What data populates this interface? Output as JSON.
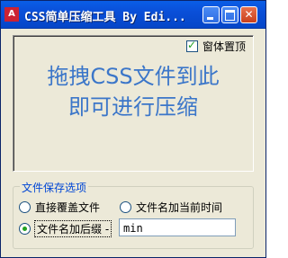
{
  "window": {
    "title": "CSS简单压缩工具 By Edi...",
    "app_icon": "A",
    "minimize_icon": "minimize-icon",
    "maximize_icon": "maximize-icon",
    "close_glyph": "✕"
  },
  "drop_area": {
    "always_on_top_label": "窗体置顶",
    "always_on_top_checked": true,
    "hint_line1": "拖拽CSS文件到此",
    "hint_line2": "即可进行压缩"
  },
  "save_options": {
    "legend": "文件保存选项",
    "options": [
      {
        "label": "直接覆盖文件",
        "selected": false
      },
      {
        "label": "文件名加当前时间",
        "selected": false
      },
      {
        "label": "文件名加后缀 -",
        "selected": true
      }
    ],
    "suffix_value": "min"
  },
  "colors": {
    "titlebar": "#0a4fd8",
    "hint_text": "#3b76c9",
    "legend_text": "#0046d5",
    "check_mark": "#21a121",
    "window_bg": "#ece9d8"
  }
}
